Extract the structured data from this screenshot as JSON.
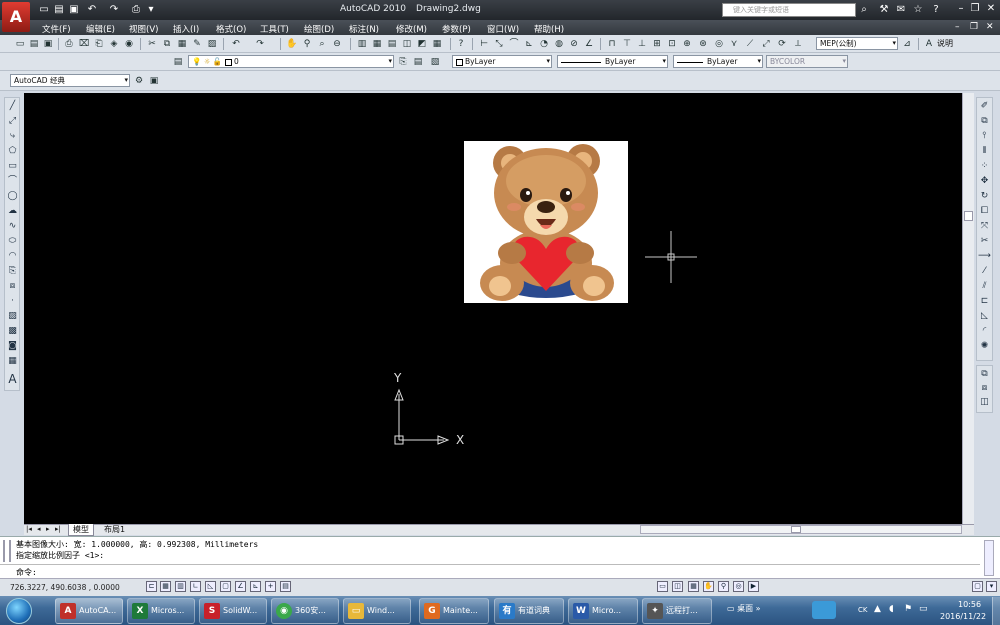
{
  "app": {
    "name": "AutoCAD 2010",
    "file": "Drawing2.dwg",
    "search_placeholder": "键入关键字或短语"
  },
  "menus": [
    "文件(F)",
    "编辑(E)",
    "视图(V)",
    "插入(I)",
    "格式(O)",
    "工具(T)",
    "绘图(D)",
    "标注(N)",
    "修改(M)",
    "参数(P)",
    "窗口(W)",
    "帮助(H)"
  ],
  "toolbars": {
    "workspace": "AutoCAD 经典",
    "layer": "0",
    "color": "ByLayer",
    "linetype": "ByLayer",
    "lineweight": "ByLayer",
    "plotstyle": "BYCOLOR",
    "dimstyle": "MEP(公制)",
    "textstyle_label": "说明"
  },
  "canvas": {
    "background": "#000000",
    "ucs_x_label": "X",
    "ucs_y_label": "Y"
  },
  "tabs": [
    "模型",
    "布局1"
  ],
  "command": {
    "line1": "基本图像大小: 宽: 1.000000, 高: 0.992308, Millimeters",
    "line2": "指定缩放比例因子 <1>:",
    "prompt": "命令:"
  },
  "status": {
    "coords": "726.3227,  490.6038 , 0.0000"
  },
  "taskbar": {
    "items": [
      {
        "label": "AutoCA...",
        "icon": "autocad-icon",
        "color": "#c0302a"
      },
      {
        "label": "Micros...",
        "icon": "excel-icon",
        "color": "#1e7a3a"
      },
      {
        "label": "SolidW...",
        "icon": "solidworks-icon",
        "color": "#c8202a"
      },
      {
        "label": "360安...",
        "icon": "360-icon",
        "color": "#3aa84a"
      },
      {
        "label": "Wind...",
        "icon": "folder-icon",
        "color": "#e8b83a"
      },
      {
        "label": "Mainte...",
        "icon": "pdf-icon",
        "color": "#e06a20"
      },
      {
        "label": "有道词典",
        "icon": "youdao-icon",
        "color": "#2a7ac8"
      },
      {
        "label": "Micro...",
        "icon": "word-icon",
        "color": "#2a5aa8"
      },
      {
        "label": "远程打...",
        "icon": "remote-icon",
        "color": "#555555"
      },
      {
        "label": "桌面",
        "icon": "desktop-icon",
        "color": "#4a7ab0"
      }
    ],
    "tray_lang": "CK",
    "time": "10:56",
    "date": "2016/11/22"
  }
}
